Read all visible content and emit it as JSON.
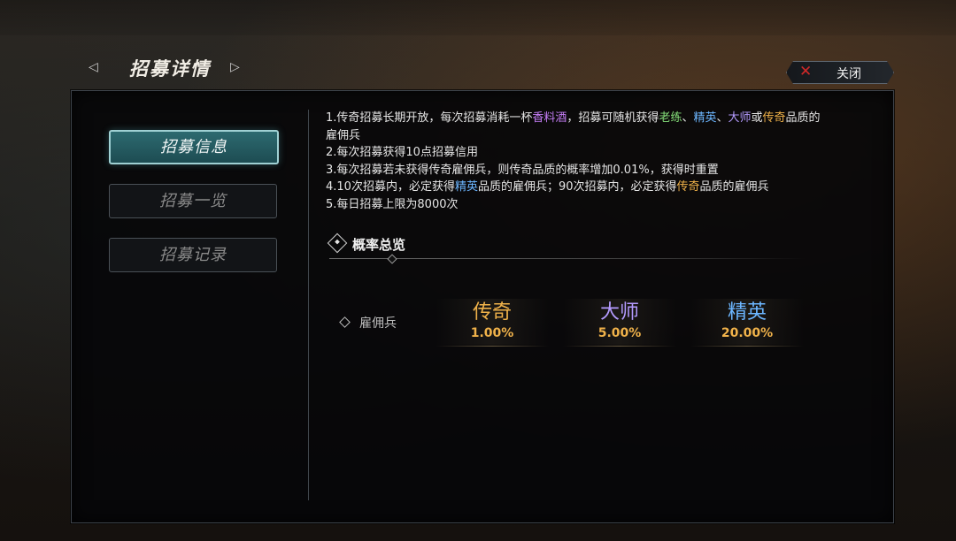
{
  "header": {
    "title": "招募详情",
    "close_label": "关闭"
  },
  "sidebar": {
    "items": [
      {
        "label": "招募信息",
        "active": true
      },
      {
        "label": "招募一览",
        "active": false
      },
      {
        "label": "招募记录",
        "active": false
      }
    ]
  },
  "rules": {
    "line1": {
      "t1": "1.传奇招募长期开放，每次招募消耗一杯",
      "item": "香料酒",
      "t2": "，招募可随机获得",
      "q1": "老练",
      "sep1": "、",
      "q2": "精英",
      "sep2": "、",
      "q3": "大师",
      "sep3": "或",
      "q4": "传奇",
      "t3": "品质的",
      "t4": "雇佣兵"
    },
    "line2": "2.每次招募获得10点招募信用",
    "line3": "3.每次招募若未获得传奇雇佣兵，则传奇品质的概率增加0.01%，获得时重置",
    "line4": {
      "t1": "4.10次招募内，必定获得",
      "q1": "精英",
      "t2": "品质的雇佣兵；90次招募内，必定获得",
      "q2": "传奇",
      "t3": "品质的雇佣兵"
    },
    "line5": "5.每日招募上限为8000次"
  },
  "overview": {
    "title": "概率总览",
    "row_label": "雇佣兵",
    "rates": [
      {
        "name": "传奇",
        "value": "1.00%",
        "color": "#f0b24a"
      },
      {
        "name": "大师",
        "value": "5.00%",
        "color": "#b49bff"
      },
      {
        "name": "精英",
        "value": "20.00%",
        "color": "#6cb6ff"
      }
    ]
  },
  "colors": {
    "accent_teal": "#2d6a70",
    "legendary": "#f0b24a",
    "master": "#b49bff",
    "elite": "#6cb6ff",
    "veteran": "#86e07a",
    "item": "#c47df5",
    "close_x": "#d02828"
  }
}
